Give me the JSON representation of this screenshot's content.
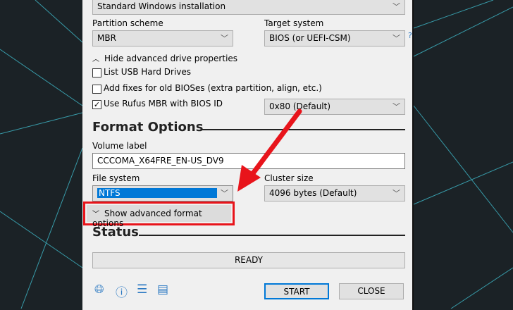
{
  "image_option": {
    "value": "Standard Windows installation"
  },
  "partition_scheme": {
    "label": "Partition scheme",
    "value": "MBR"
  },
  "target_system": {
    "label": "Target system",
    "value": "BIOS (or UEFI-CSM)",
    "help": "?"
  },
  "advanced_drive": {
    "toggle_label": "Hide advanced drive properties",
    "list_usb": {
      "label": "List USB Hard Drives",
      "checked": false
    },
    "old_bios": {
      "label": "Add fixes for old BIOSes (extra partition, align, etc.)",
      "checked": false
    },
    "rufus_mbr": {
      "label": "Use Rufus MBR with BIOS ID",
      "checked": true,
      "bios_id": "0x80 (Default)"
    }
  },
  "format_options": {
    "heading": "Format Options",
    "volume_label": {
      "label": "Volume label",
      "value": "CCCOMA_X64FRE_EN-US_DV9"
    },
    "file_system": {
      "label": "File system",
      "value": "NTFS"
    },
    "cluster_size": {
      "label": "Cluster size",
      "value": "4096 bytes (Default)"
    },
    "advanced_toggle": "Show advanced format options"
  },
  "status": {
    "heading": "Status",
    "text": "READY"
  },
  "buttons": {
    "start": "START",
    "close": "CLOSE"
  },
  "colors": {
    "accent": "#0078d7",
    "annotation": "#e8141b"
  }
}
